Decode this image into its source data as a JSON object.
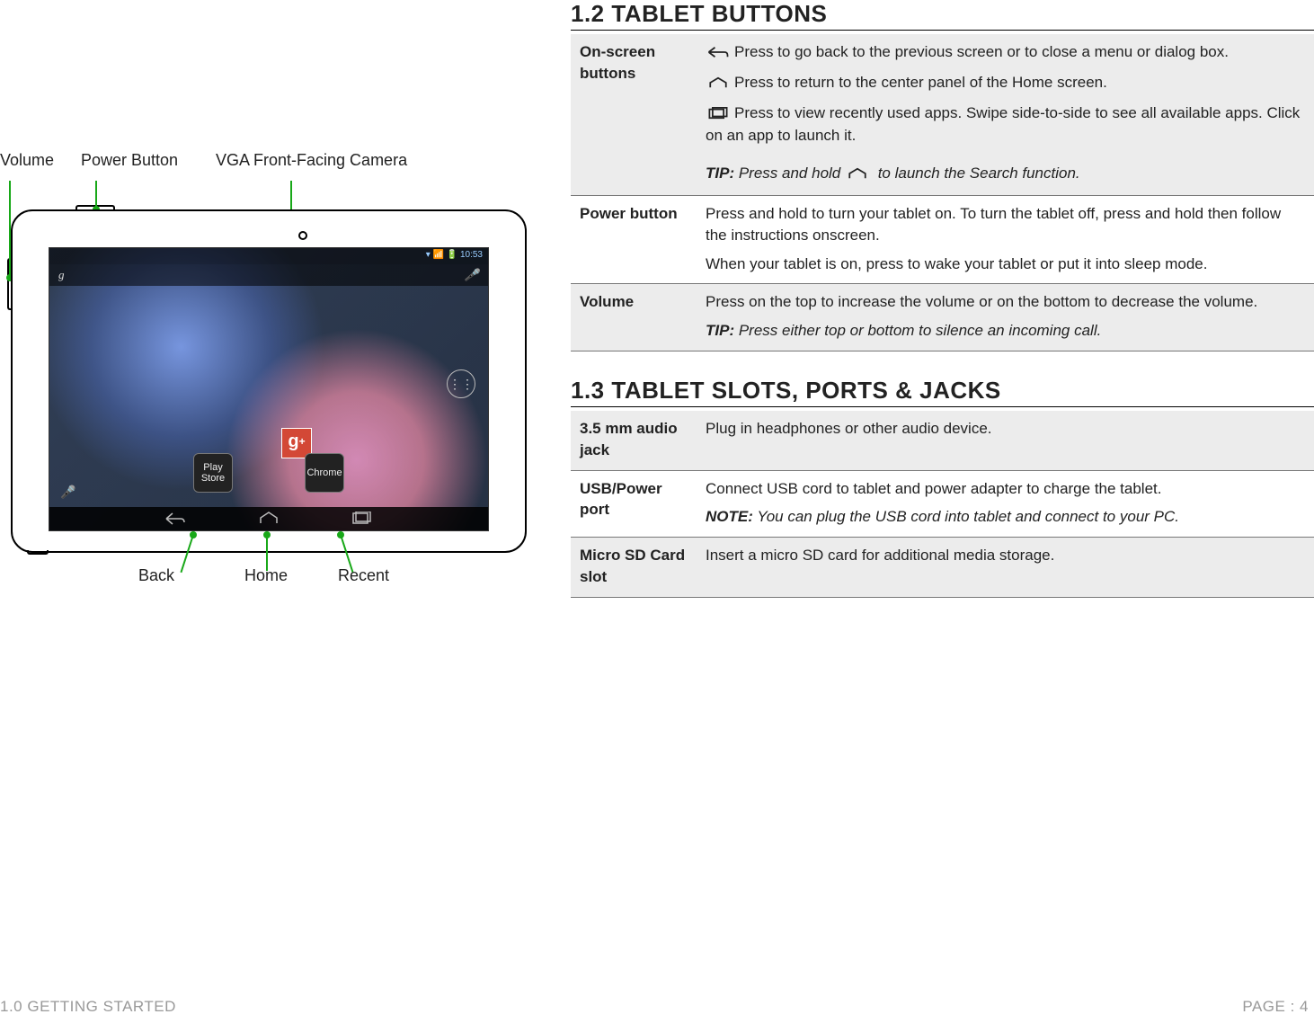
{
  "callouts": {
    "volume": "Volume",
    "power": "Power Button",
    "vga": "VGA Front-Facing Camera",
    "back": "Back",
    "home": "Home",
    "recent": "Recent"
  },
  "tablet_ui": {
    "clock": "10:53",
    "search_letter": "g",
    "mic_glyph": "🎤",
    "dock_playstore": "Play Store",
    "dock_chrome": "Chrome",
    "gplus": "g",
    "apps_glyph": "⋮⋮"
  },
  "sections": {
    "buttons_title": "1.2 TABLET BUTTONS",
    "ports_title": "1.3 TABLET SLOTS, PORTS & JACKS"
  },
  "rows_buttons": {
    "onscreen_key": "On-screen buttons",
    "onscreen_back": "Press to go back to the previous screen or to close a menu or dialog box.",
    "onscreen_home": "Press to return to the center panel of the Home screen.",
    "onscreen_recent": "Press to view recently used apps. Swipe side-to-side to see all available apps. Click on an app to launch it.",
    "onscreen_tip_label": "TIP:",
    "onscreen_tip_a": "Press and hold ",
    "onscreen_tip_b": " to launch the Search function.",
    "power_key": "Power button",
    "power_p1": "Press and hold to turn your tablet on. To turn the tablet off, press and hold then follow the instructions onscreen.",
    "power_p2": "When your tablet is on, press to wake your tablet or put it into sleep mode.",
    "volume_key": "Volume",
    "volume_p1": "Press on the top to increase the volume or on the bottom to decrease the volume.",
    "volume_tip_label": "TIP:",
    "volume_tip": "Press either top or bottom to silence an incoming call."
  },
  "rows_ports": {
    "audio_key": "3.5 mm audio jack",
    "audio_p": "Plug in headphones or other audio device.",
    "usb_key": "USB/Power port",
    "usb_p": "Connect USB cord to tablet and power adapter to charge the tablet.",
    "usb_note_label": "NOTE:",
    "usb_note": "You can plug the USB cord into tablet and connect to your PC.",
    "sd_key": "Micro SD Card slot",
    "sd_p": "Insert a micro SD card for additional media storage."
  },
  "footer": {
    "left": "1.0 GETTING STARTED",
    "right": "PAGE : 4"
  }
}
